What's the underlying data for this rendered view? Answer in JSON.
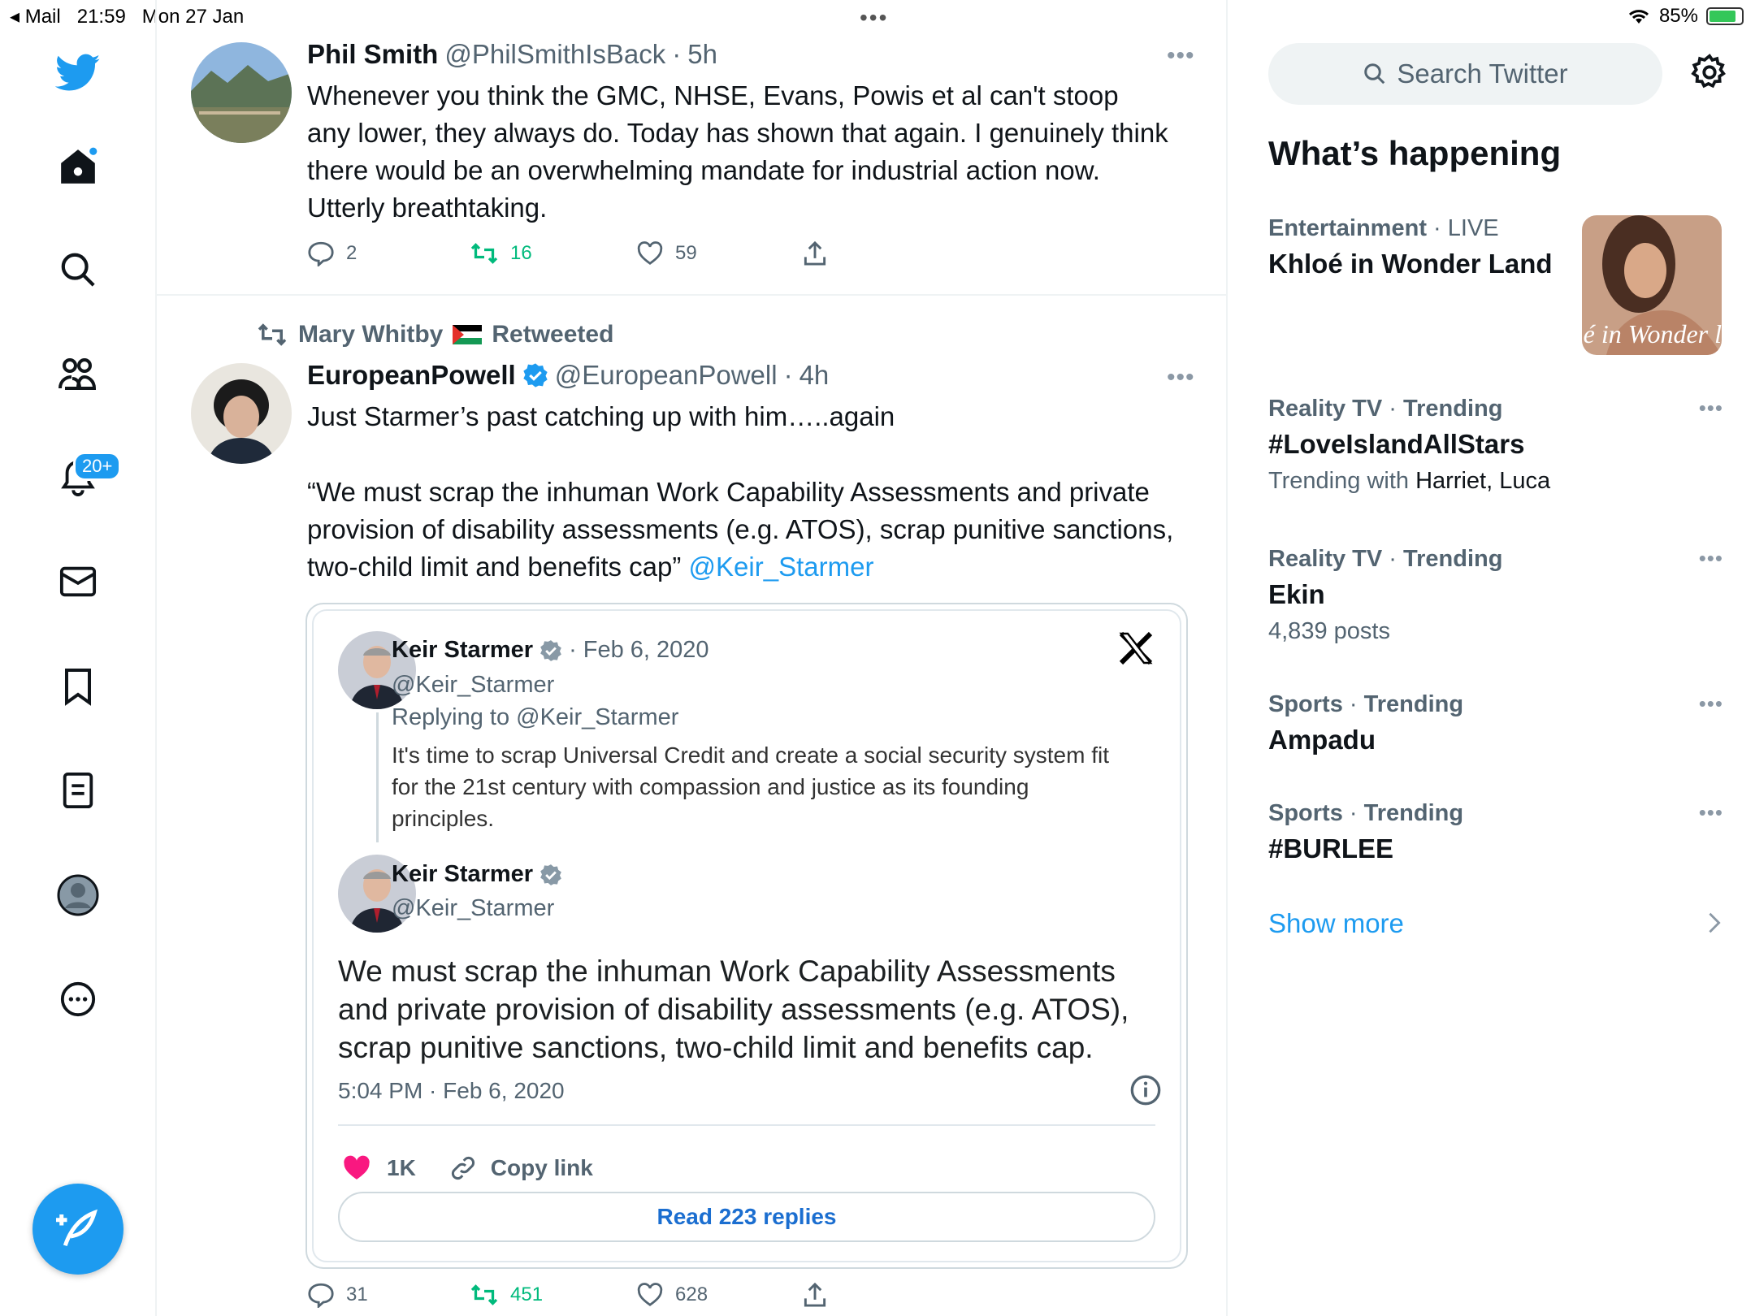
{
  "status_bar": {
    "back_app": "Mail",
    "time": "21:59",
    "date": "Mon 27 Jan",
    "battery_percent": "85%"
  },
  "nav": {
    "notifications_badge": "20+"
  },
  "tweets": [
    {
      "name": "Phil Smith",
      "handle": "@PhilSmithIsBack",
      "time": "5h",
      "text": "Whenever you think the GMC, NHSE, Evans, Powis et al can't stoop any lower, they always do.  Today has shown that again. I genuinely think there would be an overwhelming mandate for industrial action now.  Utterly breathtaking.",
      "replies": "2",
      "retweets": "16",
      "likes": "59"
    },
    {
      "retweeted_by": "Mary Whitby",
      "retweeted_label": "Retweeted",
      "name": "EuropeanPowell",
      "handle": "@EuropeanPowell",
      "time": "4h",
      "text_line1": "Just Starmer’s past catching up with him…..again",
      "text_quote": "“We must scrap the inhuman Work Capability Assessments and private provision of disability assessments (e.g. ATOS), scrap punitive sanctions, two-child limit and benefits cap”",
      "mention": "@Keir_Starmer",
      "replies": "31",
      "retweets": "451",
      "likes": "628",
      "embed": {
        "parent_name": "Keir Starmer",
        "parent_date": "Feb 6, 2020",
        "parent_handle": "@Keir_Starmer",
        "replying_to": "Replying to @Keir_Starmer",
        "parent_text": "It's time to scrap Universal Credit and create a social security system fit for the 21st century with compassion and justice as its founding principles.",
        "name": "Keir Starmer",
        "handle": "@Keir_Starmer",
        "text": "We must scrap the inhuman Work Capability Assessments and private provision of disability assessments (e.g. ATOS), scrap punitive sanctions, two-child limit and benefits cap.",
        "timestamp": "5:04 PM · Feb 6, 2020",
        "likes": "1K",
        "copy_link": "Copy link",
        "read_replies": "Read 223 replies"
      }
    }
  ],
  "sidebar": {
    "search_placeholder": "Search Twitter",
    "title": "What’s happening",
    "trends": [
      {
        "category": "Entertainment",
        "context": "LIVE",
        "title": "Khloé in Wonder Land",
        "image_caption": "é in Wonder l"
      },
      {
        "category": "Reality TV",
        "context": "Trending",
        "title": "#LoveIslandAllStars",
        "sub_prefix": "Trending with",
        "sub_value": "Harriet, Luca"
      },
      {
        "category": "Reality TV",
        "context": "Trending",
        "title": "Ekin",
        "sub": "4,839 posts"
      },
      {
        "category": "Sports",
        "context": "Trending",
        "title": "Ampadu"
      },
      {
        "category": "Sports",
        "context": "Trending",
        "title": "#BURLEE"
      }
    ],
    "show_more": "Show more"
  },
  "colors": {
    "accent": "#1d9bf0",
    "retweet": "#00ba7c",
    "secondary_text": "#536471",
    "like_heart": "#f91880"
  }
}
